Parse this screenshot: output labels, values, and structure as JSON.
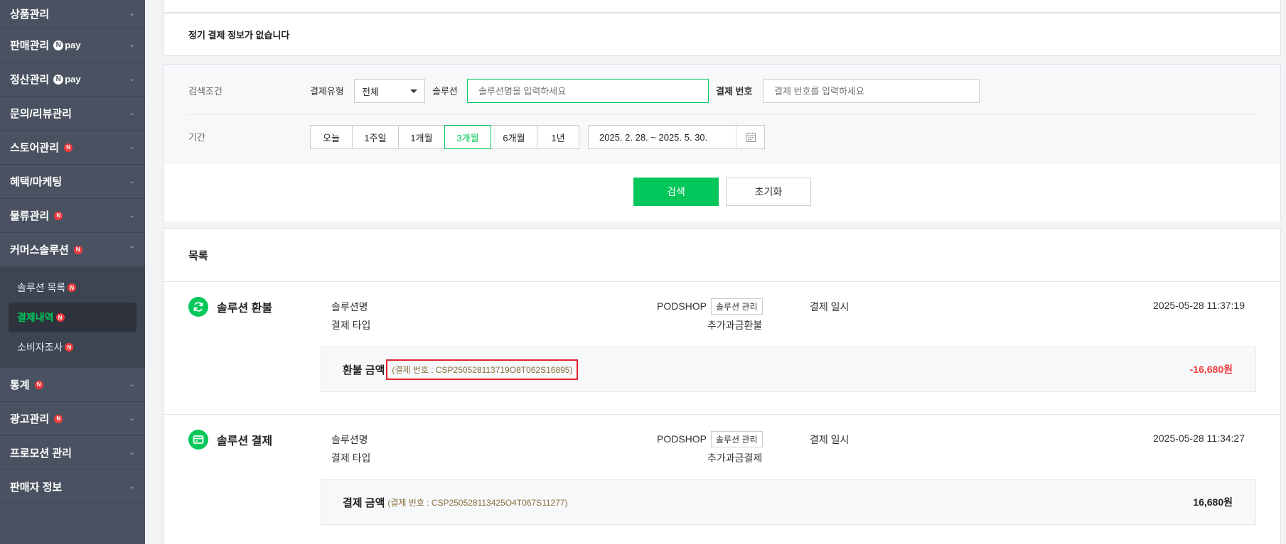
{
  "sidebar": {
    "items": [
      {
        "label": "상품관리"
      },
      {
        "label": "판매관리",
        "npay": "pay"
      },
      {
        "label": "정산관리",
        "npay": "pay"
      },
      {
        "label": "문의/리뷰관리"
      },
      {
        "label": "스토어관리",
        "badge": "N"
      },
      {
        "label": "혜택/마케팅"
      },
      {
        "label": "물류관리",
        "badge": "N"
      },
      {
        "label": "커머스솔루션",
        "badge": "N"
      }
    ],
    "submenu": [
      {
        "label": "솔루션 목록",
        "badge": "N"
      },
      {
        "label": "결제내역",
        "badge": "N"
      },
      {
        "label": "소비자조사",
        "badge": "N"
      }
    ],
    "items_after": [
      {
        "label": "통계",
        "badge": "N"
      },
      {
        "label": "광고관리",
        "badge": "N"
      },
      {
        "label": "프로모션 관리"
      },
      {
        "label": "판매자 정보"
      }
    ]
  },
  "notice": "정기 결제 정보가 없습니다",
  "search": {
    "section_label": "검색조건",
    "pay_type_label": "결제유형",
    "pay_type_value": "전체",
    "solution_label": "솔루션",
    "solution_placeholder": "솔루션명을 입력하세요",
    "paynum_label": "결제 번호",
    "paynum_placeholder": "결제 번호를 입력하세요",
    "period_label": "기간",
    "periods": [
      "오늘",
      "1주일",
      "1개월",
      "3개월",
      "6개월",
      "1년"
    ],
    "active_period": "3개월",
    "date_range": "2025. 2. 28. ~ 2025. 5. 30.",
    "search_button": "검색",
    "reset_button": "초기화"
  },
  "list": {
    "title": "목록",
    "entries": [
      {
        "title": "솔루션 환불",
        "icon": "refresh-icon",
        "name_label": "솔루션명",
        "name_value": "PODSHOP",
        "manage_tag": "솔루션 관리",
        "type_label": "결제 타입",
        "type_value": "추가과금환불",
        "date_label": "결제 일시",
        "date_value": "2025-05-28 11:37:19",
        "amount_label": "환불 금액",
        "paynum": "(결제 번호 : CSP250528113719O8T062S16895)",
        "amount": "-16,680원"
      },
      {
        "title": "솔루션 결제",
        "icon": "card-icon",
        "name_label": "솔루션명",
        "name_value": "PODSHOP",
        "manage_tag": "솔루션 관리",
        "type_label": "결제 타입",
        "type_value": "추가과금결제",
        "date_label": "결제 일시",
        "date_value": "2025-05-28 11:34:27",
        "amount_label": "결제 금액",
        "paynum": "(결제 번호 : CSP250528113425O4T067S11277)",
        "amount": "16,680원"
      }
    ]
  },
  "colors": {
    "accent": "#03c75a",
    "sidebar": "#4a5261",
    "negative": "#f23a3c",
    "highlight_border": "#e0232b"
  }
}
